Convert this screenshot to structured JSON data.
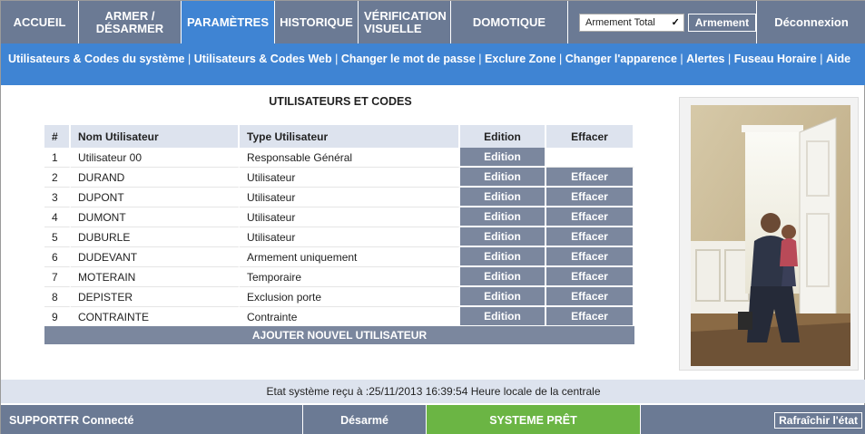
{
  "nav": {
    "items": [
      {
        "label": "ACCUEIL"
      },
      {
        "label": "ARMER / DÉSARMER"
      },
      {
        "label": "PARAMÈTRES"
      },
      {
        "label": "HISTORIQUE"
      },
      {
        "label": "VÉRIFICATION VISUELLE"
      },
      {
        "label": "DOMOTIQUE"
      }
    ],
    "arm_mode_select": "Armement Total",
    "arm_button": "Armement",
    "logout": "Déconnexion"
  },
  "subnav": {
    "links": [
      "Utilisateurs & Codes du système",
      "Utilisateurs & Codes Web",
      "Changer le mot de passe",
      "Exclure Zone",
      "Changer l'apparence",
      "Alertes",
      "Fuseau Horaire",
      "Aide"
    ],
    "separator": "|"
  },
  "main": {
    "title": "UTILISATEURS ET CODES",
    "columns": [
      "#",
      "Nom Utilisateur",
      "Type Utilisateur",
      "Edition",
      "Effacer"
    ],
    "rows": [
      {
        "num": "1",
        "name": "Utilisateur 00",
        "type": "Responsable Général",
        "edit": "Edition",
        "delete": ""
      },
      {
        "num": "2",
        "name": "DURAND",
        "type": "Utilisateur",
        "edit": "Edition",
        "delete": "Effacer"
      },
      {
        "num": "3",
        "name": "DUPONT",
        "type": "Utilisateur",
        "edit": "Edition",
        "delete": "Effacer"
      },
      {
        "num": "4",
        "name": "DUMONT",
        "type": "Utilisateur",
        "edit": "Edition",
        "delete": "Effacer"
      },
      {
        "num": "5",
        "name": "DUBURLE",
        "type": "Utilisateur",
        "edit": "Edition",
        "delete": "Effacer"
      },
      {
        "num": "6",
        "name": "DUDEVANT",
        "type": "Armement uniquement",
        "edit": "Edition",
        "delete": "Effacer"
      },
      {
        "num": "7",
        "name": "MOTERAIN",
        "type": "Temporaire",
        "edit": "Edition",
        "delete": "Effacer"
      },
      {
        "num": "8",
        "name": "DEPISTER",
        "type": "Exclusion porte",
        "edit": "Edition",
        "delete": "Effacer"
      },
      {
        "num": "9",
        "name": "CONTRAINTE",
        "type": "Contrainte",
        "edit": "Edition",
        "delete": "Effacer"
      }
    ],
    "add_user": "AJOUTER NOUVEL UTILISATEUR"
  },
  "status": {
    "line": "Etat système reçu à :25/11/2013 16:39:54 Heure locale de la centrale",
    "connection": "SUPPORTFR Connecté",
    "arm_state": "Désarmé",
    "system_state": "SYSTEME PRÊT",
    "refresh": "Rafraîchir l'état"
  },
  "colors": {
    "nav_bg": "#6b7a94",
    "active_blue": "#3f84d3",
    "button_bg": "#7b879e",
    "header_bg": "#dde3ee",
    "ready_green": "#6bb544"
  }
}
